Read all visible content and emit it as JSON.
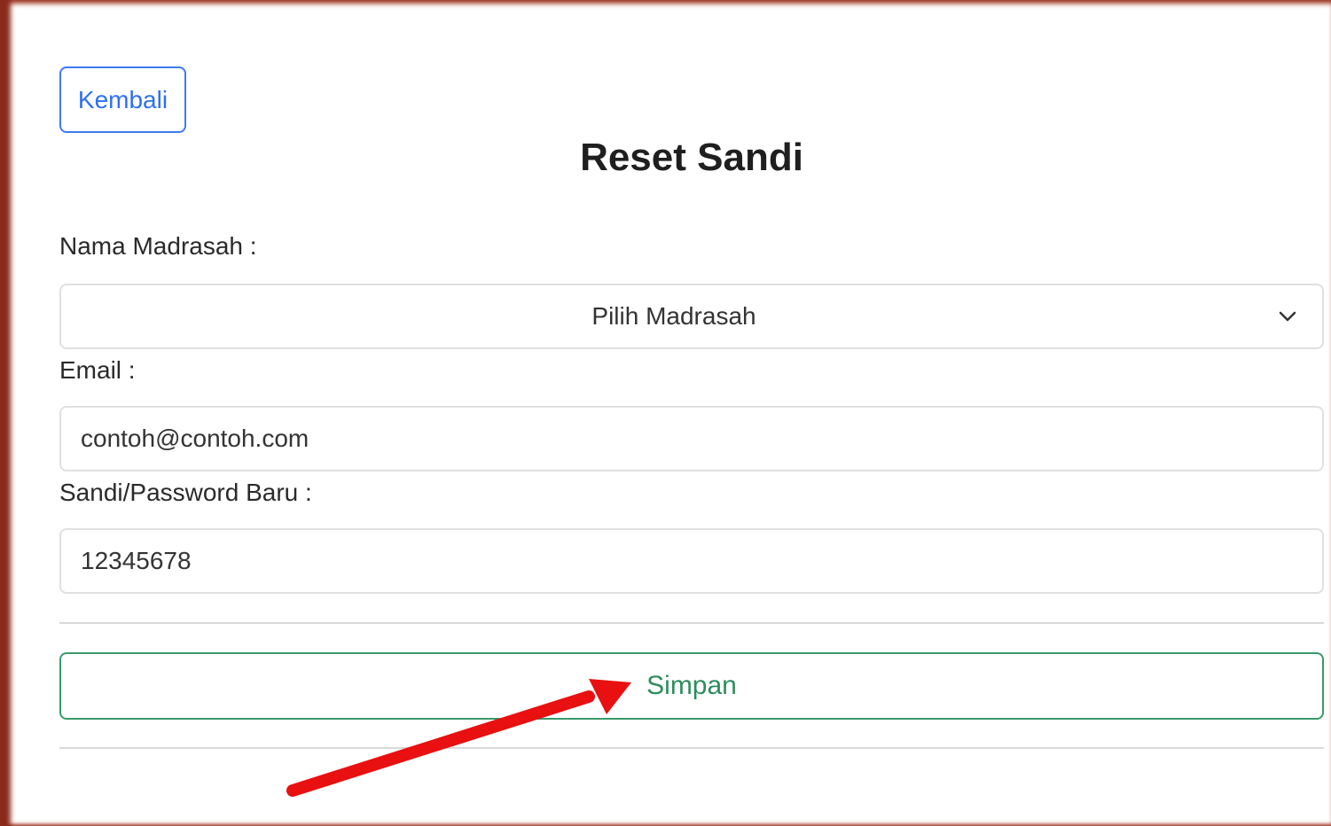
{
  "toolbar": {
    "back_label": "Kembali"
  },
  "page": {
    "title": "Reset Sandi"
  },
  "form": {
    "madrasah": {
      "label": "Nama Madrasah :",
      "selected": "Pilih Madrasah"
    },
    "email": {
      "label": "Email :",
      "value": "contoh@contoh.com"
    },
    "password": {
      "label": "Sandi/Password Baru :",
      "value": "12345678"
    },
    "save_label": "Simpan"
  },
  "annotation": {
    "arrow_color": "#e81010"
  },
  "colors": {
    "back_accent": "#3d7bf0",
    "save_accent": "#3a9a6a"
  },
  "icons": {
    "select_chevron": "chevron-down-icon",
    "annotation": "red-arrow-icon"
  }
}
